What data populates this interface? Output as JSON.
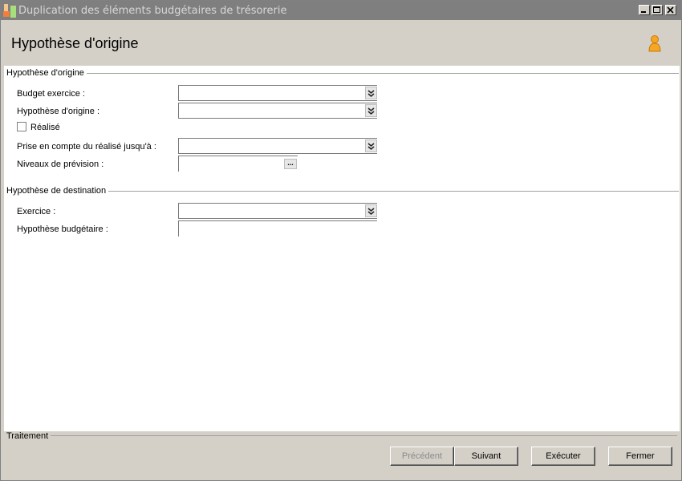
{
  "window": {
    "title": "Duplication des éléments budgétaires de trésorerie"
  },
  "header": {
    "title": "Hypothèse d'origine"
  },
  "sections": {
    "origin": {
      "legend": "Hypothèse d'origine",
      "budget_exercice_label": "Budget exercice :",
      "budget_exercice_value": "",
      "hypothese_origine_label": "Hypothèse d'origine :",
      "hypothese_origine_value": "",
      "realise_label": "Réalisé",
      "realise_checked": false,
      "prise_en_compte_label": "Prise en compte du réalisé jusqu'à :",
      "prise_en_compte_value": "",
      "niveaux_label": "Niveaux de prévision :",
      "niveaux_value": "",
      "niveaux_button": "..."
    },
    "destination": {
      "legend": "Hypothèse de destination",
      "exercice_label": "Exercice :",
      "exercice_value": "",
      "hypothese_budgetaire_label": "Hypothèse budgétaire :",
      "hypothese_budgetaire_value": ""
    }
  },
  "footer": {
    "legend": "Traitement",
    "buttons": {
      "precedent": "Précédent",
      "suivant": "Suivant",
      "executer": "Exécuter",
      "fermer": "Fermer"
    }
  },
  "colors": {
    "titlebar_bg": "#7f7f7f",
    "window_bg": "#d4d0c8",
    "content_bg": "#ffffff",
    "user_icon": "#f5a623"
  }
}
